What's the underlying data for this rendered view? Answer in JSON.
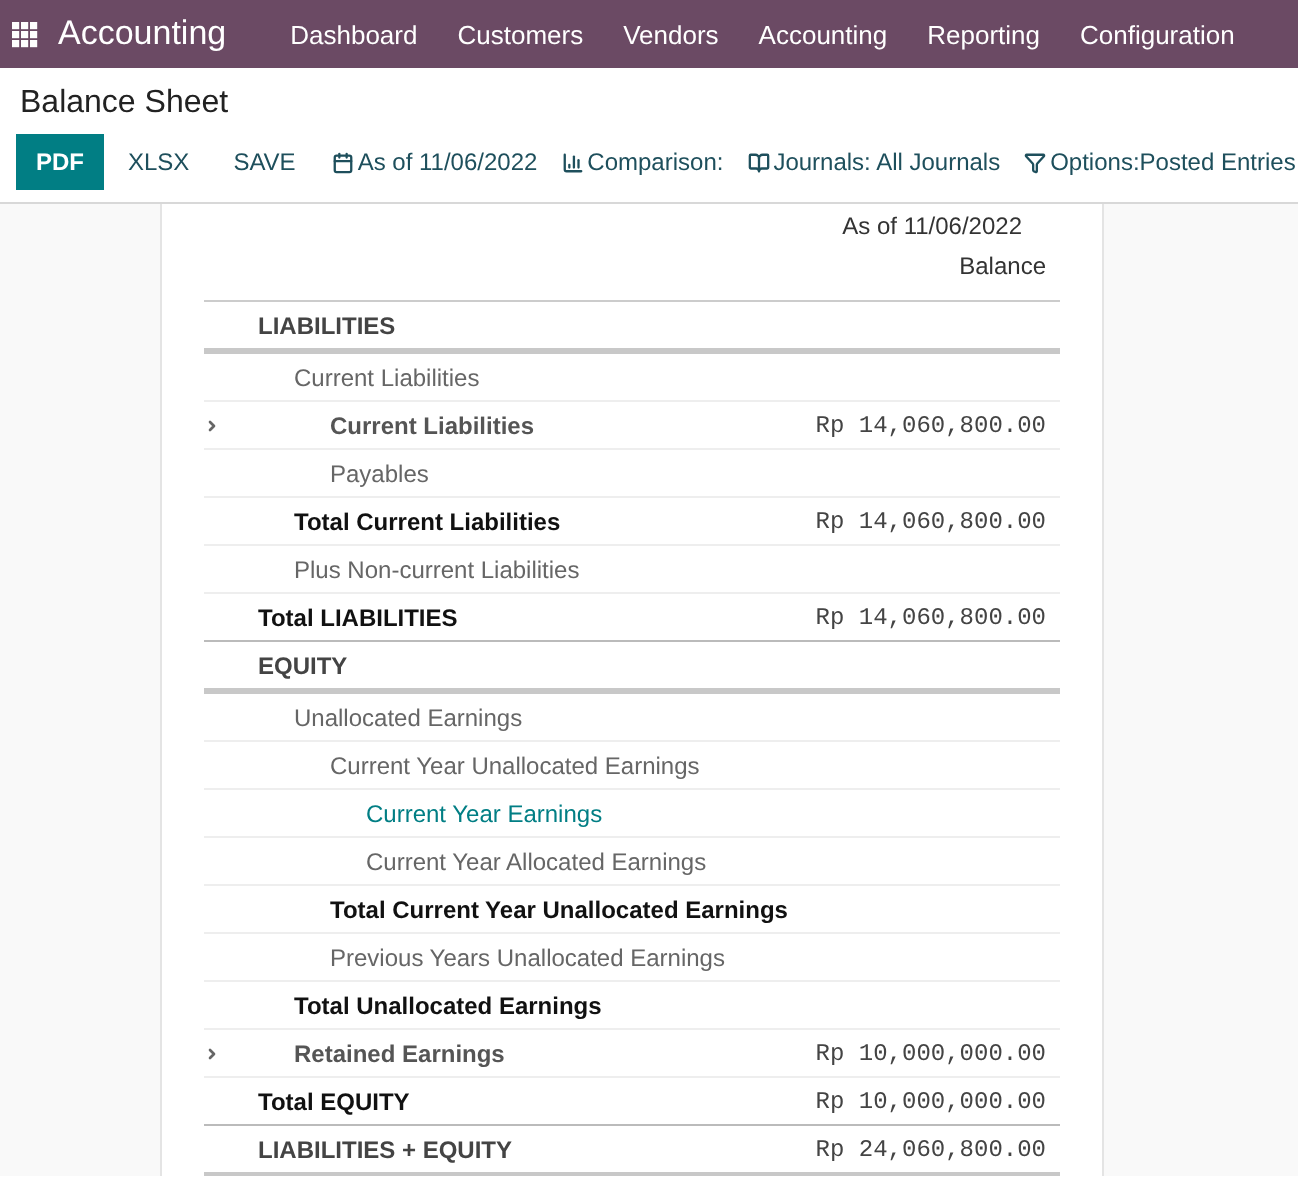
{
  "app": {
    "name": "Accounting",
    "menu": [
      "Dashboard",
      "Customers",
      "Vendors",
      "Accounting",
      "Reporting",
      "Configuration"
    ]
  },
  "page_title": "Balance Sheet",
  "toolbar": {
    "buttons": [
      {
        "label": "PDF",
        "primary": true
      },
      {
        "label": "XLSX",
        "primary": false
      },
      {
        "label": "SAVE",
        "primary": false
      }
    ],
    "filters": [
      {
        "kind": "date",
        "label": "As of 11/06/2022"
      },
      {
        "kind": "comparison",
        "label": "Comparison:"
      },
      {
        "kind": "journals",
        "label": "Journals: All Journals"
      },
      {
        "kind": "options",
        "label": "Options:Posted Entries"
      }
    ]
  },
  "report": {
    "period": "As of 11/06/2022",
    "column": "Balance",
    "rows": [
      {
        "kind": "section",
        "label": "LIABILITIES",
        "children": [
          {
            "kind": "line",
            "label": "Current Liabilities",
            "children": [
              {
                "kind": "group",
                "label": "Current Liabilities",
                "amount": "Rp 14,060,800.00",
                "expanded": false
              },
              {
                "kind": "line",
                "label": "Payables"
              }
            ]
          },
          {
            "kind": "total",
            "label": "Total Current Liabilities",
            "amount": "Rp 14,060,800.00"
          },
          {
            "kind": "line",
            "label": "Plus Non-current Liabilities"
          }
        ]
      },
      {
        "kind": "total",
        "label": "Total LIABILITIES",
        "amount": "Rp 14,060,800.00"
      },
      {
        "kind": "section",
        "label": "EQUITY",
        "children": [
          {
            "kind": "line",
            "label": "Unallocated Earnings",
            "children": [
              {
                "kind": "line",
                "label": "Current Year Unallocated Earnings",
                "children": [
                  {
                    "kind": "link",
                    "label": "Current Year Earnings"
                  },
                  {
                    "kind": "line",
                    "label": "Current Year Allocated Earnings"
                  }
                ]
              },
              {
                "kind": "total",
                "label": "Total Current Year Unallocated Earnings"
              },
              {
                "kind": "line",
                "label": "Previous Years Unallocated Earnings"
              }
            ]
          },
          {
            "kind": "total",
            "label": "Total Unallocated Earnings"
          },
          {
            "kind": "group",
            "label": "Retained Earnings",
            "amount": "Rp 10,000,000.00",
            "expanded": false
          }
        ]
      },
      {
        "kind": "total",
        "label": "Total EQUITY",
        "amount": "Rp 10,000,000.00"
      },
      {
        "kind": "grand",
        "label": "LIABILITIES + EQUITY",
        "amount": "Rp 24,060,800.00"
      }
    ]
  }
}
